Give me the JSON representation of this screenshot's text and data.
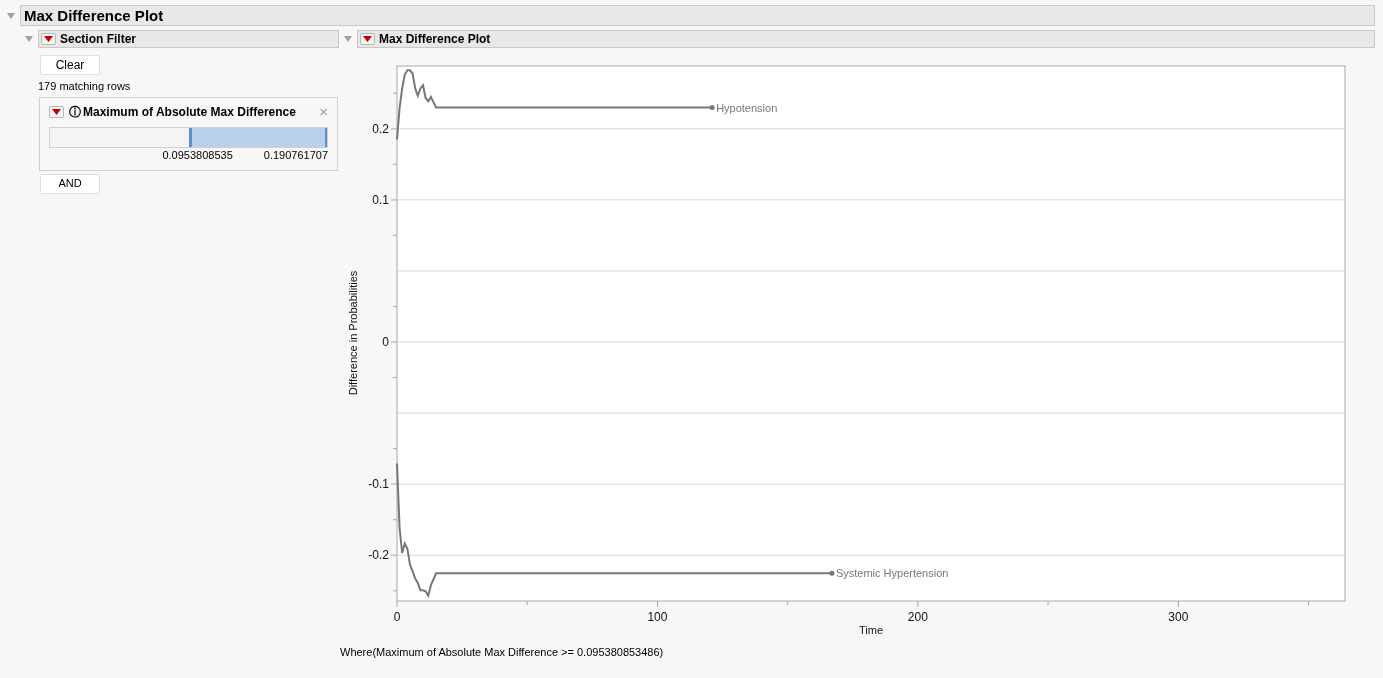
{
  "report": {
    "title": "Max Difference Plot",
    "expanded": true
  },
  "filter": {
    "title": "Section Filter",
    "expanded": true,
    "clear_button": "Clear",
    "matching": "179 matching rows",
    "item": {
      "title": "Maximum of Absolute Max Difference",
      "info_icon": "ⓘ",
      "close": "×",
      "slider": {
        "level": 0.5
      },
      "low": "0.0953808535",
      "high": "0.190761707"
    },
    "and_button": "AND"
  },
  "plot": {
    "title": "Max Difference Plot",
    "expanded": true,
    "chart_data": {
      "type": "line",
      "xlabel": "Time",
      "ylabel": "Difference in Probabilities",
      "x": [
        0,
        1,
        2,
        3,
        4,
        5,
        6,
        7,
        8,
        9,
        10,
        11,
        12,
        13,
        15,
        121,
        167
      ],
      "series": [
        {
          "name": "Hypotension",
          "color": "#777777",
          "values": [
            0.19,
            0.22,
            0.238,
            0.251,
            0.255,
            0.255,
            0.252,
            0.238,
            0.231,
            0.238,
            0.241,
            0.229,
            0.226,
            0.23,
            0.22,
            0.22,
            null
          ]
        },
        {
          "name": "Systemic Hypertension",
          "color": "#777777",
          "values": [
            -0.114,
            -0.175,
            -0.198,
            -0.189,
            -0.194,
            -0.209,
            -0.215,
            -0.222,
            -0.226,
            -0.233,
            -0.233,
            -0.234,
            -0.238,
            -0.228,
            -0.217,
            -0.217,
            -0.217
          ]
        }
      ],
      "xlim": [
        0,
        364
      ],
      "ylim": [
        -0.243,
        0.259
      ],
      "xticks": [
        0,
        100,
        200,
        300
      ],
      "yticks": [
        -0.2,
        {
          "value": -0.1333,
          "label": "-0.1"
        },
        0,
        {
          "value": 0.1333,
          "label": "0.1"
        },
        0.2
      ],
      "grid": true
    },
    "where": "Where(Maximum of Absolute Max Difference >= 0.095380853486)"
  }
}
